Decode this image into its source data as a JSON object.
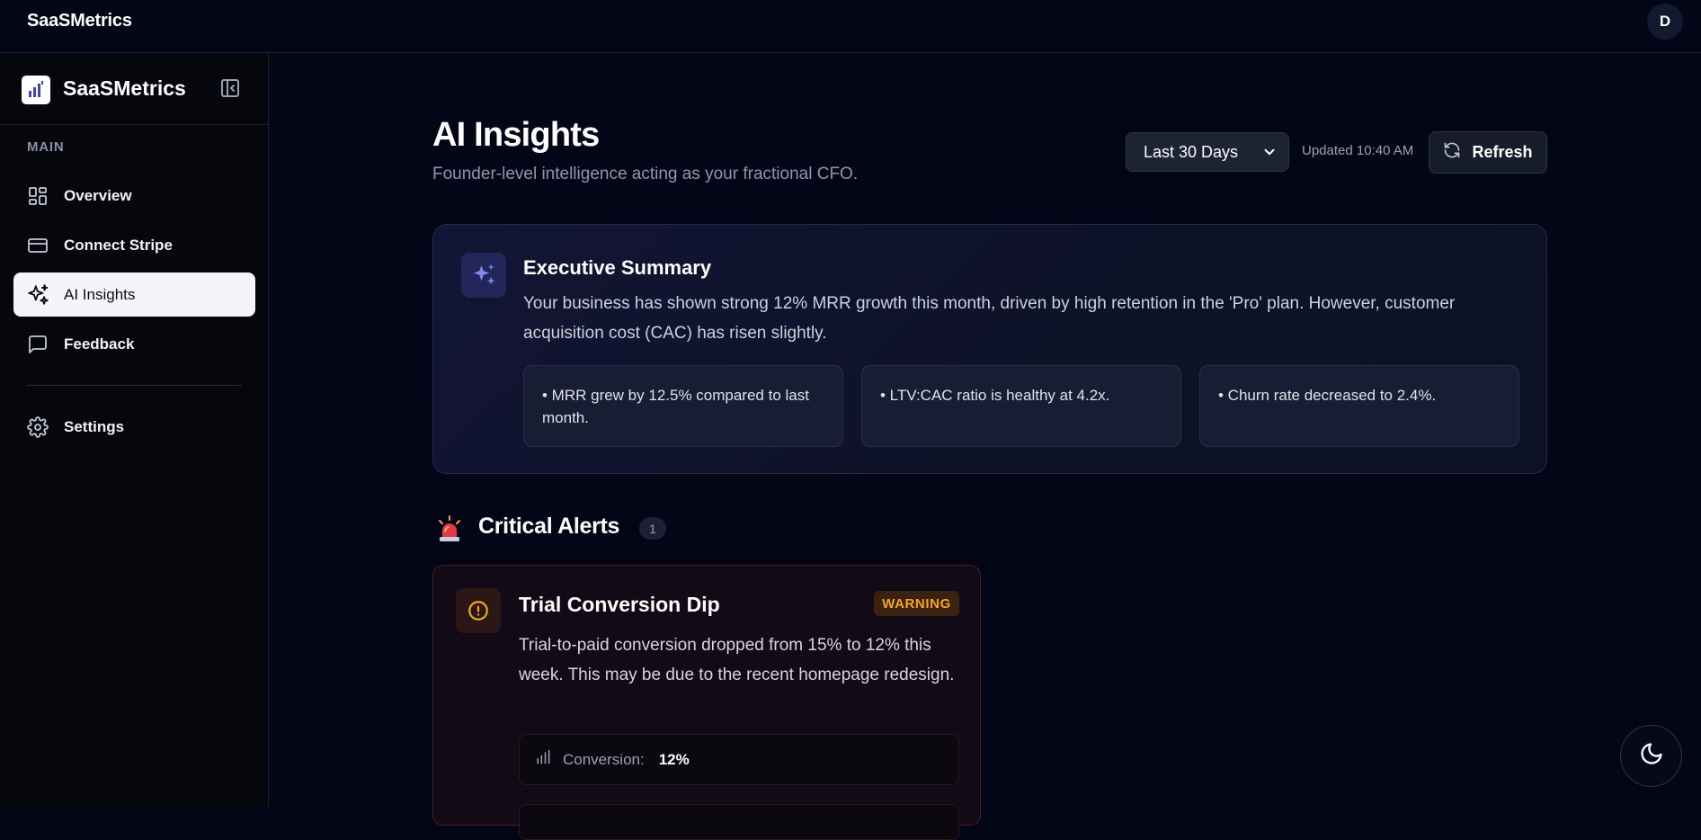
{
  "app": {
    "brand": "SaaSMetrics",
    "user_initial": "D"
  },
  "sidebar": {
    "brand": "SaaSMetrics",
    "section_label": "MAIN",
    "items": [
      {
        "label": "Overview",
        "icon": "grid-icon",
        "active": false
      },
      {
        "label": "Connect Stripe",
        "icon": "credit-card-icon",
        "active": false
      },
      {
        "label": "AI Insights",
        "icon": "sparkles-icon",
        "active": true
      },
      {
        "label": "Feedback",
        "icon": "message-square-icon",
        "active": false
      }
    ],
    "settings_label": "Settings"
  },
  "header": {
    "title": "AI Insights",
    "subtitle": "Founder-level intelligence acting as your fractional CFO.",
    "range_select": {
      "value": "Last 30 Days"
    },
    "updated": "Updated 10:40 AM",
    "refresh_label": "Refresh"
  },
  "summary": {
    "title": "Executive Summary",
    "body": "Your business has shown strong 12% MRR growth this month, driven by high retention in the 'Pro' plan. However, customer acquisition cost (CAC) has risen slightly.",
    "points": [
      "• MRR grew by 12.5% compared to last month.",
      "• LTV:CAC ratio is healthy at 4.2x.",
      "• Churn rate decreased to 2.4%."
    ]
  },
  "alerts": {
    "title": "Critical Alerts",
    "count": "1",
    "items": [
      {
        "title": "Trial Conversion Dip",
        "badge": "WARNING",
        "body": "Trial-to-paid conversion dropped from 15% to 12% this week. This may be due to the recent homepage redesign.",
        "metric_label": "Conversion:",
        "metric_value": "12%"
      }
    ]
  },
  "colors": {
    "background": "#030616",
    "sidebar": "#05070d",
    "accent": "#6d79f5",
    "warning": "#f5a623",
    "alert_border": "#4a1c1c"
  }
}
